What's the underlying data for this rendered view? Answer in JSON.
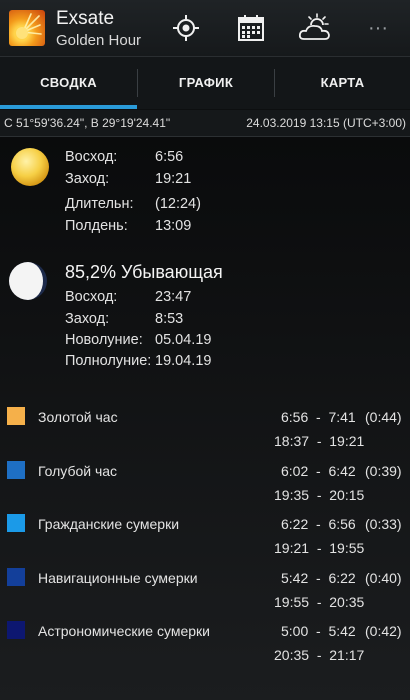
{
  "app": {
    "title": "Exsate",
    "subtitle": "Golden Hour"
  },
  "toolbar": {
    "icons": [
      "location-target-icon",
      "calendar-icon",
      "weather-sun-cloud-icon",
      "more-icon"
    ],
    "more_label": "···"
  },
  "tabs": [
    {
      "label": "СВОДКА",
      "active": true
    },
    {
      "label": "ГРАФИК",
      "active": false
    },
    {
      "label": "КАРТА",
      "active": false
    }
  ],
  "accent_color": "#2a9bd9",
  "info": {
    "coords": "С 51°59'36.24\", В 29°19'24.41\"",
    "datetime": "24.03.2019 13:15 (UTC+3:00)"
  },
  "sun": {
    "rise_label": "Восход:",
    "rise": "6:56",
    "set_label": "Заход:",
    "set": "19:21",
    "length_label": "Длительн:",
    "length": "(12:24)",
    "noon_label": "Полдень:",
    "noon": "13:09"
  },
  "moon": {
    "phase": "85,2% Убывающая",
    "illumination": 0.852,
    "rise_label": "Восход:",
    "rise": "23:47",
    "set_label": "Заход:",
    "set": "8:53",
    "new_label": "Новолуние:",
    "new": "05.04.19",
    "full_label": "Полнолуние:",
    "full": "19.04.19"
  },
  "periods": [
    {
      "name": "Золотой час",
      "color": "#f5b04a",
      "morning": "6:56  -  7:41",
      "duration": "(0:44)",
      "evening": "18:37  -  19:21"
    },
    {
      "name": "Голубой час",
      "color": "#1e6fc4",
      "morning": "6:02  -  6:42",
      "duration": "(0:39)",
      "evening": "19:35  -  20:15"
    },
    {
      "name": "Гражданские сумерки",
      "color": "#1b9ae8",
      "morning": "6:22  -  6:56",
      "duration": "(0:33)",
      "evening": "19:21  -  19:55"
    },
    {
      "name": "Навигационные сумерки",
      "color": "#133f9a",
      "morning": "5:42  -  6:22",
      "duration": "(0:40)",
      "evening": "19:55  -  20:35"
    },
    {
      "name": "Астрономические сумерки",
      "color": "#0d1770",
      "morning": "5:00  -  5:42",
      "duration": "(0:42)",
      "evening": "20:35  -  21:17"
    }
  ]
}
